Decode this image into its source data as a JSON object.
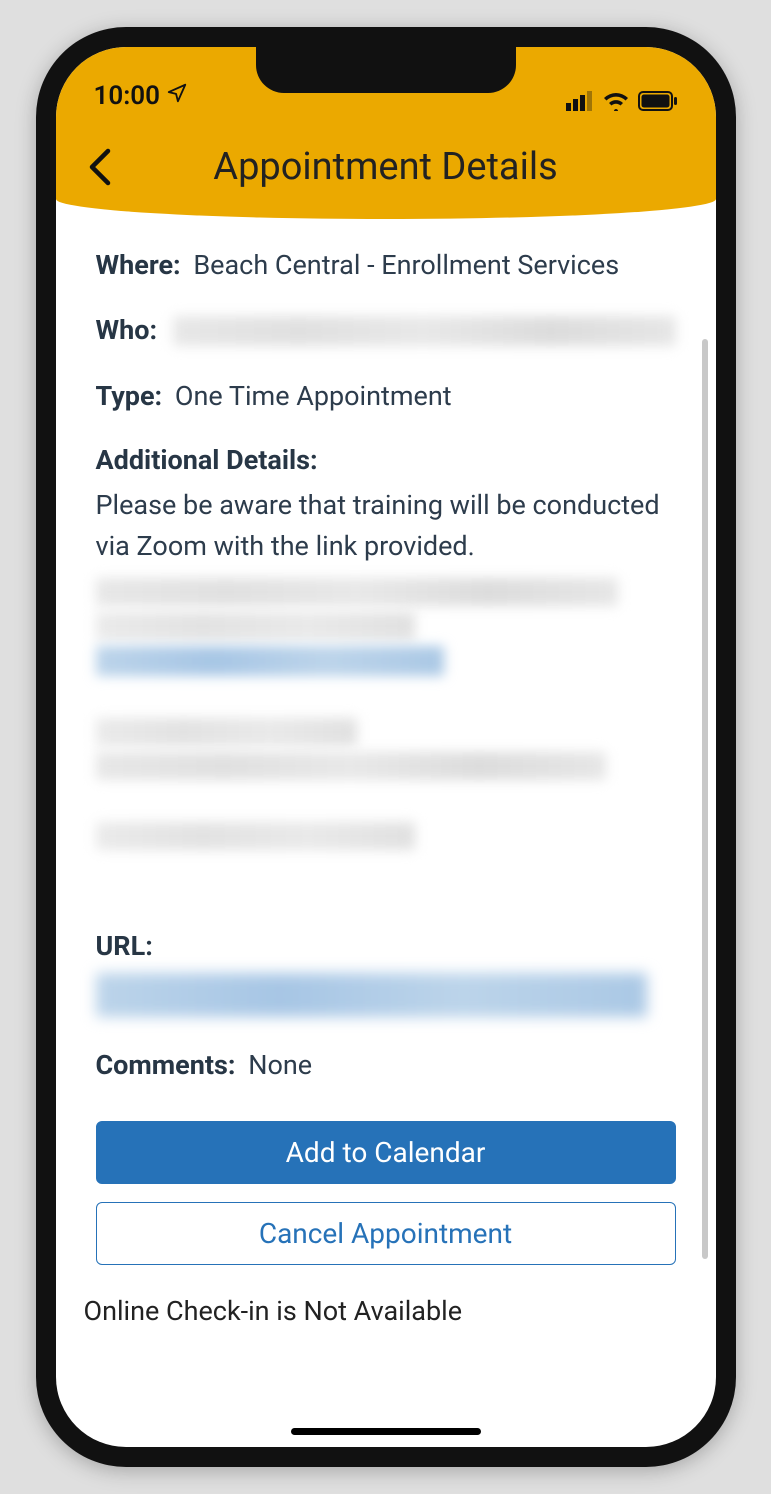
{
  "status": {
    "time": "10:00"
  },
  "nav": {
    "title": "Appointment Details"
  },
  "fields": {
    "where_label": "Where:",
    "where_value": "Beach Central - Enrollment Services",
    "who_label": "Who:",
    "type_label": "Type:",
    "type_value": "One Time Appointment",
    "additional_label": "Additional Details:",
    "additional_text": "Please be aware that training will be conducted via Zoom with the link provided.",
    "url_label": "URL:",
    "comments_label": "Comments:",
    "comments_value": "None"
  },
  "buttons": {
    "add_calendar": "Add to Calendar",
    "cancel_appointment": "Cancel Appointment"
  },
  "footer": {
    "checkin_note": "Online Check-in is Not Available"
  }
}
